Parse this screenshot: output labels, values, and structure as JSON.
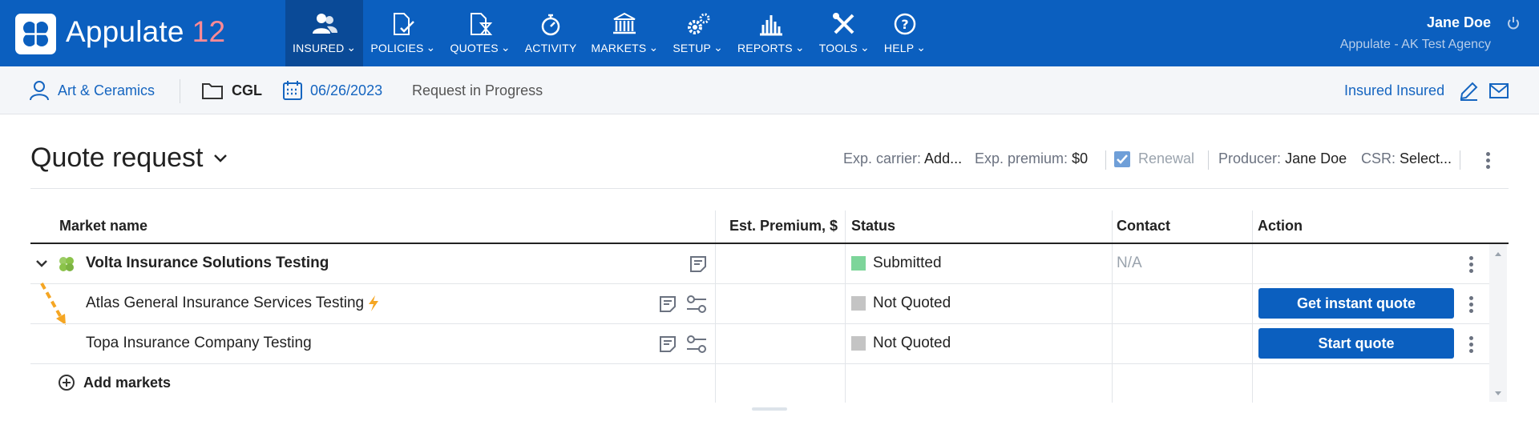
{
  "app": {
    "brand_name": "Appulate",
    "brand_version": "12"
  },
  "nav": [
    {
      "label": "INSURED",
      "icon": "users-icon"
    },
    {
      "label": "POLICIES",
      "icon": "policy-document-icon"
    },
    {
      "label": "QUOTES",
      "icon": "quote-hourglass-icon"
    },
    {
      "label": "ACTIVITY",
      "icon": "stopwatch-icon"
    },
    {
      "label": "MARKETS",
      "icon": "bank-building-icon"
    },
    {
      "label": "SETUP",
      "icon": "gears-icon"
    },
    {
      "label": "REPORTS",
      "icon": "bar-chart-icon"
    },
    {
      "label": "TOOLS",
      "icon": "wrench-screwdriver-icon"
    },
    {
      "label": "HELP",
      "icon": "help-circle-icon"
    }
  ],
  "user": {
    "name": "Jane Doe",
    "agency": "Appulate - AK Test Agency"
  },
  "subheader": {
    "insured_name": "Art & Ceramics",
    "line_of_business": "CGL",
    "date": "06/26/2023",
    "status": "Request in Progress",
    "contact_name": "Insured Insured"
  },
  "page": {
    "title": "Quote request",
    "exp_carrier_label": "Exp. carrier:",
    "exp_carrier_value": "Add...",
    "exp_premium_label": "Exp. premium:",
    "exp_premium_value": "$0",
    "renewal_label": "Renewal",
    "renewal_checked": true,
    "producer_label": "Producer:",
    "producer_value": "Jane Doe",
    "csr_label": "CSR:",
    "csr_value": "Select..."
  },
  "table": {
    "columns": [
      "Market name",
      "Est. Premium, $",
      "Status",
      "Contact",
      "Action"
    ],
    "rows": [
      {
        "market": "Volta Insurance Solutions Testing",
        "premium": "",
        "status": "Submitted",
        "status_color": "#7dd59a",
        "contact": "N/A",
        "action": ""
      },
      {
        "market": "Atlas General Insurance Services Testing",
        "premium": "",
        "status": "Not Quoted",
        "status_color": "#c4c4c4",
        "contact": "",
        "action": "Get instant quote"
      },
      {
        "market": "Topa Insurance Company Testing",
        "premium": "",
        "status": "Not Quoted",
        "status_color": "#c4c4c4",
        "contact": "",
        "action": "Start quote"
      }
    ],
    "add_markets_label": "Add markets"
  },
  "colors": {
    "topbar": "#0b5fbf",
    "active_nav": "#0a4a97",
    "accent_link": "#1565c0",
    "version": "#ff8a95",
    "lightning": "#f5a623"
  }
}
